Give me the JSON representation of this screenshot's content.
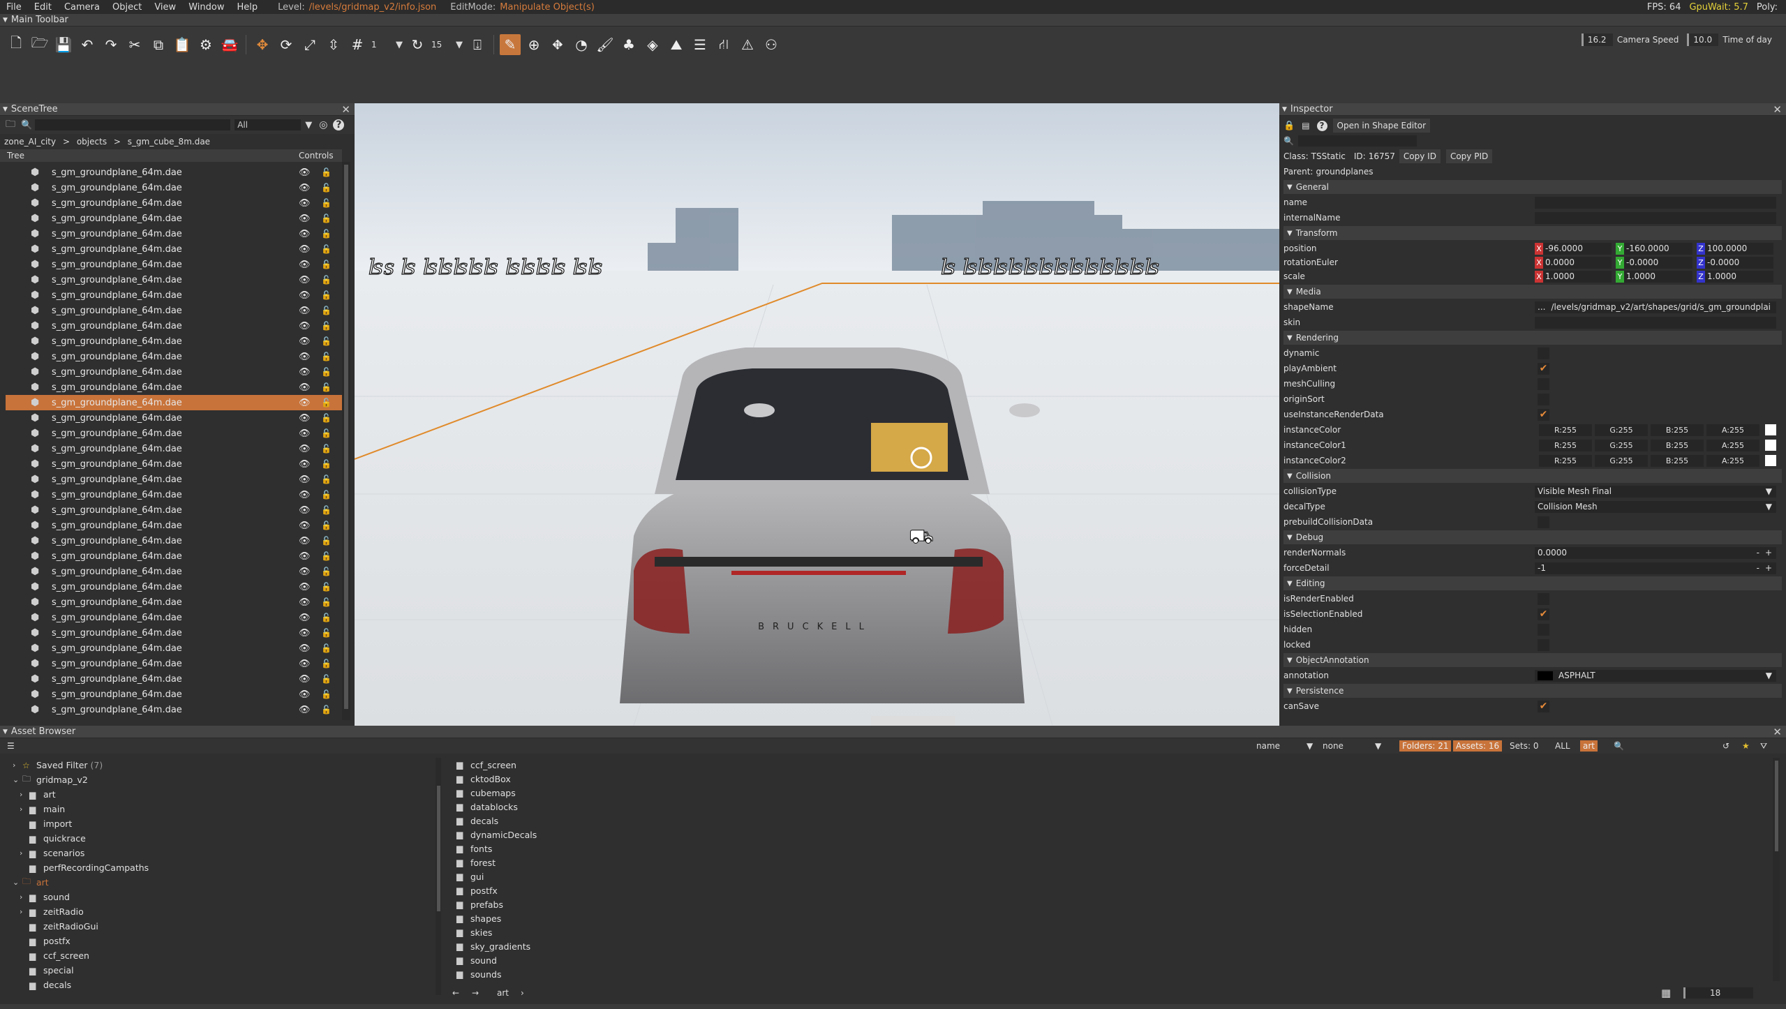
{
  "menu": {
    "items": [
      "File",
      "Edit",
      "Camera",
      "Object",
      "View",
      "Window",
      "Help"
    ],
    "level_label": "Level:",
    "level_value": "/levels/gridmap_v2/info.json",
    "editmode_label": "EditMode:",
    "editmode_value": "Manipulate Object(s)",
    "fps": "FPS: 64",
    "gpuwait": "GpuWait: 5.7",
    "poly": "Poly:"
  },
  "toolbar": {
    "title": "Main Toolbar",
    "grid_value": "1",
    "rotate_value": "15",
    "fov_value": "16.2",
    "camera_speed_label": "Camera Speed",
    "camera_speed_value": "10.0",
    "time_of_day_label": "Time of day"
  },
  "scenetree": {
    "title": "SceneTree",
    "filter_value": "All",
    "breadcrumb": [
      "zone_AI_city",
      "objects",
      "s_gm_cube_8m.dae"
    ],
    "col_tree": "Tree",
    "col_controls": "Controls",
    "item_name": "s_gm_groundplane_64m.dae",
    "item_count": 36,
    "selected_index": 15
  },
  "inspector": {
    "title": "Inspector",
    "open_shape_editor": "Open in Shape Editor",
    "class_label": "Class:",
    "class_value": "TSStatic",
    "id_label": "ID:",
    "id_value": "16757",
    "copy_id": "Copy ID",
    "copy_pid": "Copy PID",
    "parent_label": "Parent:",
    "parent_value": "groundplanes",
    "general": "General",
    "name": "name",
    "internalName": "internalName",
    "transform": "Transform",
    "position": "position",
    "position_x": "-96.0000",
    "position_y": "-160.0000",
    "position_z": "100.0000",
    "rotationEuler": "rotationEuler",
    "rot_x": "0.0000",
    "rot_y": "-0.0000",
    "rot_z": "-0.0000",
    "scale": "scale",
    "scale_x": "1.0000",
    "scale_y": "1.0000",
    "scale_z": "1.0000",
    "media": "Media",
    "shapeName": "shapeName",
    "shapeName_value": "/levels/gridmap_v2/art/shapes/grid/s_gm_groundplai",
    "skin": "skin",
    "rendering": "Rendering",
    "dynamic": "dynamic",
    "playAmbient": "playAmbient",
    "meshCulling": "meshCulling",
    "originSort": "originSort",
    "useInstanceRenderData": "useInstanceRenderData",
    "instanceColor": "instanceColor",
    "instanceColor1": "instanceColor1",
    "instanceColor2": "instanceColor2",
    "r": "R:255",
    "g": "G:255",
    "b": "B:255",
    "a": "A:255",
    "collision": "Collision",
    "collisionType": "collisionType",
    "collisionType_value": "Visible Mesh Final",
    "decalType": "decalType",
    "decalType_value": "Collision Mesh",
    "prebuildCollisionData": "prebuildCollisionData",
    "debug": "Debug",
    "renderNormals": "renderNormals",
    "renderNormals_value": "0.0000",
    "forceDetail": "forceDetail",
    "forceDetail_value": "-1",
    "editing": "Editing",
    "isRenderEnabled": "isRenderEnabled",
    "isSelectionEnabled": "isSelectionEnabled",
    "hidden": "hidden",
    "locked": "locked",
    "objectAnnotation": "ObjectAnnotation",
    "annotation": "annotation",
    "annotation_value": "ASPHALT",
    "persistence": "Persistence",
    "canSave": "canSave"
  },
  "assetbrowser": {
    "title": "Asset Browser",
    "sort_label": "name",
    "group_label": "none",
    "folders": "Folders: 21",
    "assets": "Assets: 16",
    "sets": "Sets: 0",
    "all": "ALL",
    "art": "art",
    "saved_filter": "Saved Filter",
    "saved_filter_count": "(7)",
    "tree": [
      {
        "label": "gridmap_v2",
        "indent": 0,
        "open": true
      },
      {
        "label": "art",
        "indent": 1,
        "chev": true
      },
      {
        "label": "main",
        "indent": 1,
        "chev": true
      },
      {
        "label": "import",
        "indent": 1
      },
      {
        "label": "quickrace",
        "indent": 1
      },
      {
        "label": "scenarios",
        "indent": 1,
        "chev": true
      },
      {
        "label": "perfRecordingCampaths",
        "indent": 1
      }
    ],
    "art_root": "art",
    "art_tree": [
      "sound",
      "zeitRadio",
      "zeitRadioGui",
      "postfx",
      "ccf_screen",
      "special",
      "decals"
    ],
    "folders_list": [
      "ccf_screen",
      "cktodBox",
      "cubemaps",
      "datablocks",
      "decals",
      "dynamicDecals",
      "fonts",
      "forest",
      "gui",
      "postfx",
      "prefabs",
      "shapes",
      "skies",
      "sky_gradients",
      "sound",
      "sounds"
    ],
    "footer_path": "art",
    "zoom_value": "18"
  }
}
